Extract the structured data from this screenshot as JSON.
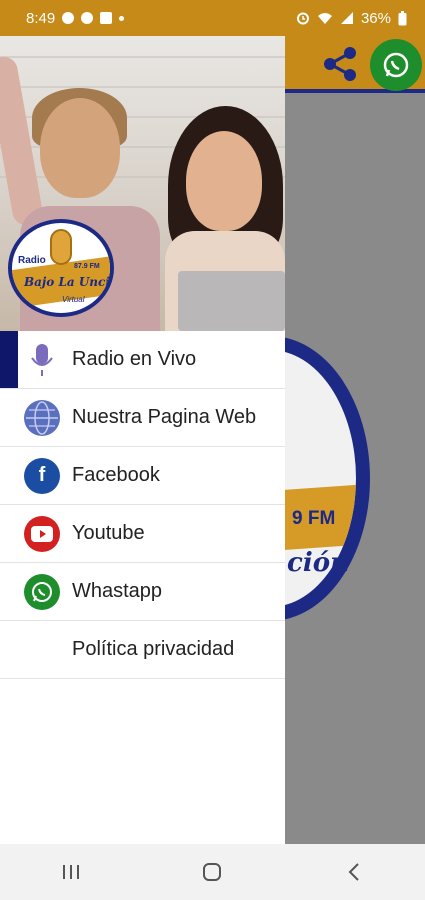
{
  "status_bar": {
    "time": "8:49",
    "battery": "36%"
  },
  "toolbar": {
    "share_icon": "share-icon",
    "whatsapp_icon": "whatsapp-icon"
  },
  "background_logo": {
    "frequency": "9 FM",
    "word": "ción"
  },
  "drawer": {
    "header_logo": {
      "radio": "Radio",
      "frequency": "87.9 FM",
      "name": "Bajo La Unción",
      "subtitle": "Virtual"
    },
    "items": [
      {
        "label": "Radio en Vivo",
        "icon": "microphone-icon",
        "active": true
      },
      {
        "label": "Nuestra Pagina Web",
        "icon": "globe-icon",
        "active": false
      },
      {
        "label": "Facebook",
        "icon": "facebook-icon",
        "active": false
      },
      {
        "label": "Youtube",
        "icon": "youtube-icon",
        "active": false
      },
      {
        "label": "Whastapp",
        "icon": "whatsapp-icon",
        "active": false
      },
      {
        "label": "Política privacidad",
        "icon": "",
        "active": false
      }
    ]
  },
  "colors": {
    "accent": "#c68a18",
    "brand_blue": "#1c2a86",
    "active_bar": "#0f176b",
    "facebook": "#1b4ea3",
    "youtube": "#d32020",
    "whatsapp": "#1e8d2c"
  },
  "nav": {
    "recents_icon": "recents-icon",
    "home_icon": "home-icon",
    "back_icon": "back-icon"
  }
}
